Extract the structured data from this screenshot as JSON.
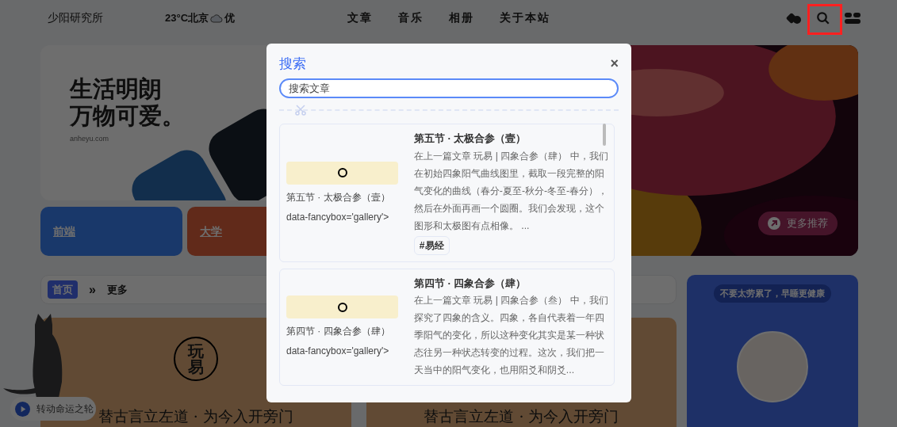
{
  "header": {
    "site_title": "少阳研究所",
    "weather": {
      "reading": "23°C北京",
      "quality": "优"
    },
    "nav": [
      {
        "label": "文章"
      },
      {
        "label": "音乐"
      },
      {
        "label": "相册"
      },
      {
        "label": "关于本站"
      }
    ],
    "search_highlighted": true
  },
  "hero": {
    "headline": [
      "生活明朗",
      "万物可爱。"
    ],
    "domain": "anheyu.com",
    "categories": [
      {
        "label": "前端"
      },
      {
        "label": "大学"
      }
    ],
    "more_button": "更多推荐"
  },
  "breadcrumb": {
    "home": "首页",
    "separator": "»",
    "current": "更多"
  },
  "articles": [
    {
      "seal": [
        "玩",
        "易"
      ],
      "title": "替古言立左道 · 为今入开旁门"
    },
    {
      "title": "替古言立左道 · 为今入开旁门"
    }
  ],
  "side_card": {
    "tip": "不要太劳累了，早睡更健康"
  },
  "music": {
    "label": "转动命运之轮"
  },
  "search_dialog": {
    "title": "搜索",
    "close": "×",
    "placeholder": "搜索文章",
    "results": [
      {
        "caption": [
          "第五节 · 太极合参（壹）",
          "data-fancybox='gallery'>"
        ],
        "title": "第五节 · 太极合参（壹）",
        "excerpt": "在上一篇文章 玩易 | 四象合参（肆） 中，我们在初始四象阳气曲线图里，截取一段完整的阳气变化的曲线（春分-夏至-秋分-冬至-春分），然后在外面再画一个圆圈。我们会发现，这个图形和太极图有点相像。 ...",
        "tags": [
          "#易经"
        ]
      },
      {
        "caption": [
          "第四节 · 四象合参（肆）",
          "data-fancybox='gallery'>"
        ],
        "title": "第四节 · 四象合参（肆）",
        "excerpt": "在上一篇文章 玩易 | 四象合参（叁） 中，我们探究了四象的含义。四象，各自代表着一年四季阳气的变化，所以这种变化其实是某一种状态往另一种状态转变的过程。这次，我们把一天当中的阳气变化，也用阳爻和阴爻..."
      }
    ]
  }
}
